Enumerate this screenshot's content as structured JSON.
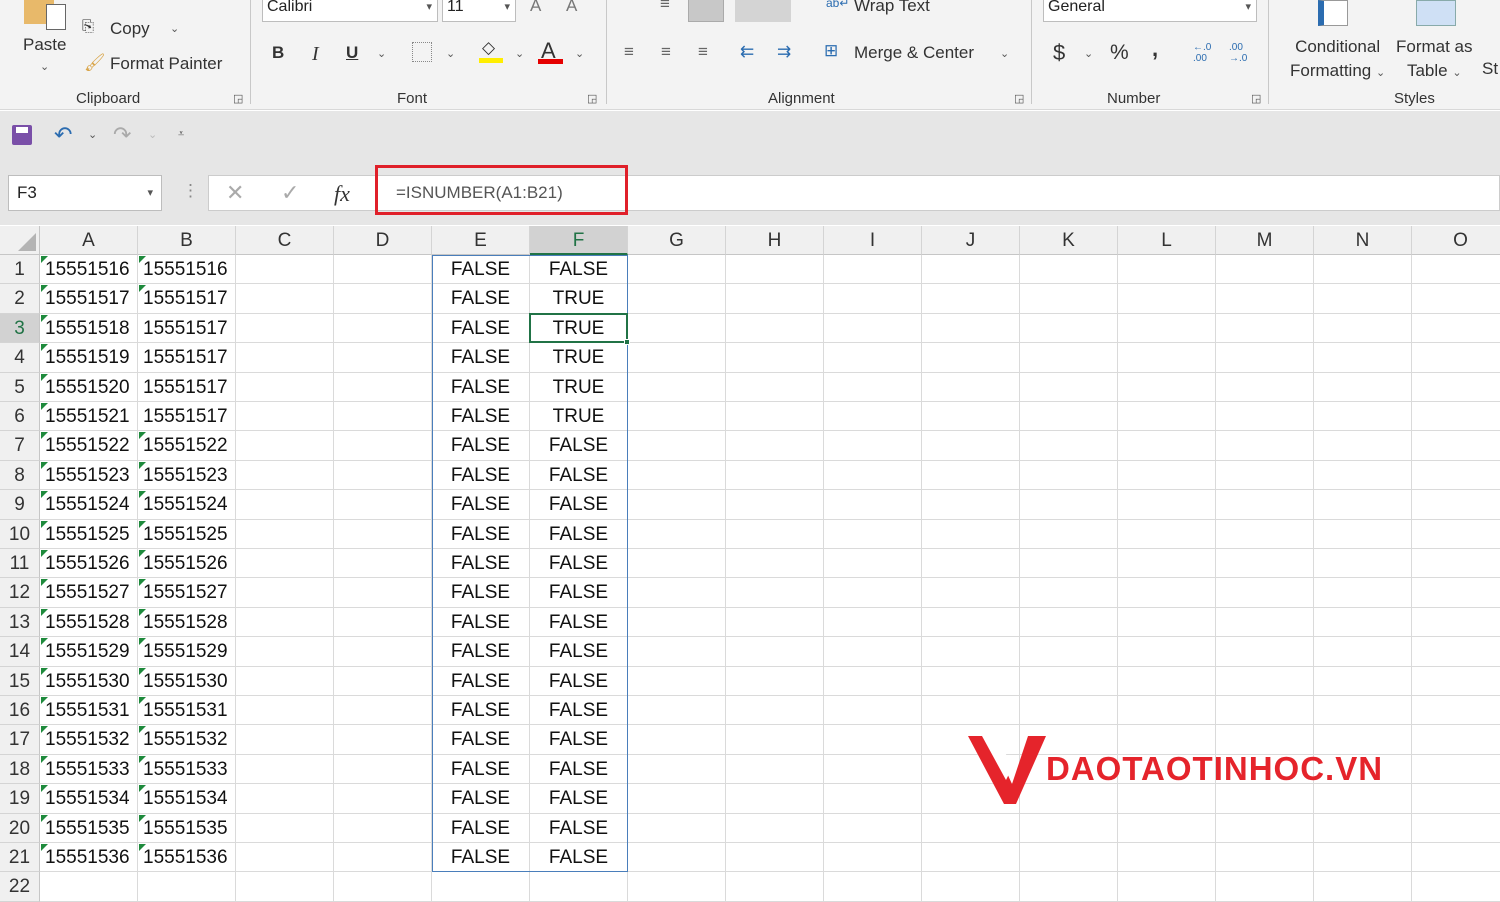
{
  "ribbon": {
    "clipboard": {
      "paste": "Paste",
      "copy": "Copy",
      "format_painter": "Format Painter",
      "label": "Clipboard"
    },
    "font": {
      "name": "Calibri",
      "size": "11",
      "bold": "B",
      "italic": "I",
      "underline": "U",
      "label": "Font"
    },
    "alignment": {
      "wrap_text": "Wrap Text",
      "merge_center": "Merge & Center",
      "label": "Alignment"
    },
    "number": {
      "format": "General",
      "currency": "$",
      "percent": "%",
      "comma": ",",
      "label": "Number"
    },
    "styles": {
      "conditional1": "Conditional",
      "conditional2": "Formatting",
      "format_as1": "Format as",
      "format_as2": "Table",
      "cell_styles": "St",
      "label": "Styles"
    }
  },
  "formula_bar": {
    "name_box": "F3",
    "fx": "fx",
    "formula": "=ISNUMBER(A1:B21)"
  },
  "sheet": {
    "columns": [
      "A",
      "B",
      "C",
      "D",
      "E",
      "F",
      "G",
      "H",
      "I",
      "J",
      "K",
      "L",
      "M",
      "N",
      "O"
    ],
    "selected_column": "F",
    "active_cell": "F3",
    "active_row": 3,
    "rows": [
      {
        "n": "1",
        "A": "15551516",
        "B": "15551516",
        "E": "FALSE",
        "F": "FALSE"
      },
      {
        "n": "2",
        "A": "15551517",
        "B": "15551517",
        "E": "FALSE",
        "F": "TRUE"
      },
      {
        "n": "3",
        "A": "15551518",
        "B": "15551517",
        "E": "FALSE",
        "F": "TRUE"
      },
      {
        "n": "4",
        "A": "15551519",
        "B": "15551517",
        "E": "FALSE",
        "F": "TRUE"
      },
      {
        "n": "5",
        "A": "15551520",
        "B": "15551517",
        "E": "FALSE",
        "F": "TRUE"
      },
      {
        "n": "6",
        "A": "15551521",
        "B": "15551517",
        "E": "FALSE",
        "F": "TRUE"
      },
      {
        "n": "7",
        "A": "15551522",
        "B": "15551522",
        "E": "FALSE",
        "F": "FALSE"
      },
      {
        "n": "8",
        "A": "15551523",
        "B": "15551523",
        "E": "FALSE",
        "F": "FALSE"
      },
      {
        "n": "9",
        "A": "15551524",
        "B": "15551524",
        "E": "FALSE",
        "F": "FALSE"
      },
      {
        "n": "10",
        "A": "15551525",
        "B": "15551525",
        "E": "FALSE",
        "F": "FALSE"
      },
      {
        "n": "11",
        "A": "15551526",
        "B": "15551526",
        "E": "FALSE",
        "F": "FALSE"
      },
      {
        "n": "12",
        "A": "15551527",
        "B": "15551527",
        "E": "FALSE",
        "F": "FALSE"
      },
      {
        "n": "13",
        "A": "15551528",
        "B": "15551528",
        "E": "FALSE",
        "F": "FALSE"
      },
      {
        "n": "14",
        "A": "15551529",
        "B": "15551529",
        "E": "FALSE",
        "F": "FALSE"
      },
      {
        "n": "15",
        "A": "15551530",
        "B": "15551530",
        "E": "FALSE",
        "F": "FALSE"
      },
      {
        "n": "16",
        "A": "15551531",
        "B": "15551531",
        "E": "FALSE",
        "F": "FALSE"
      },
      {
        "n": "17",
        "A": "15551532",
        "B": "15551532",
        "E": "FALSE",
        "F": "FALSE"
      },
      {
        "n": "18",
        "A": "15551533",
        "B": "15551533",
        "E": "FALSE",
        "F": "FALSE"
      },
      {
        "n": "19",
        "A": "15551534",
        "B": "15551534",
        "E": "FALSE",
        "F": "FALSE"
      },
      {
        "n": "20",
        "A": "15551535",
        "B": "15551535",
        "E": "FALSE",
        "F": "FALSE"
      },
      {
        "n": "21",
        "A": "15551536",
        "B": "15551536",
        "E": "FALSE",
        "F": "FALSE"
      },
      {
        "n": "22"
      }
    ]
  },
  "watermark": {
    "text": "DAOTAOTINHOC.VN",
    "color": "#e5242b"
  },
  "colors": {
    "highlight_red": "#e0202a",
    "active_green": "#217346",
    "selection_blue": "#4a7ebb"
  }
}
